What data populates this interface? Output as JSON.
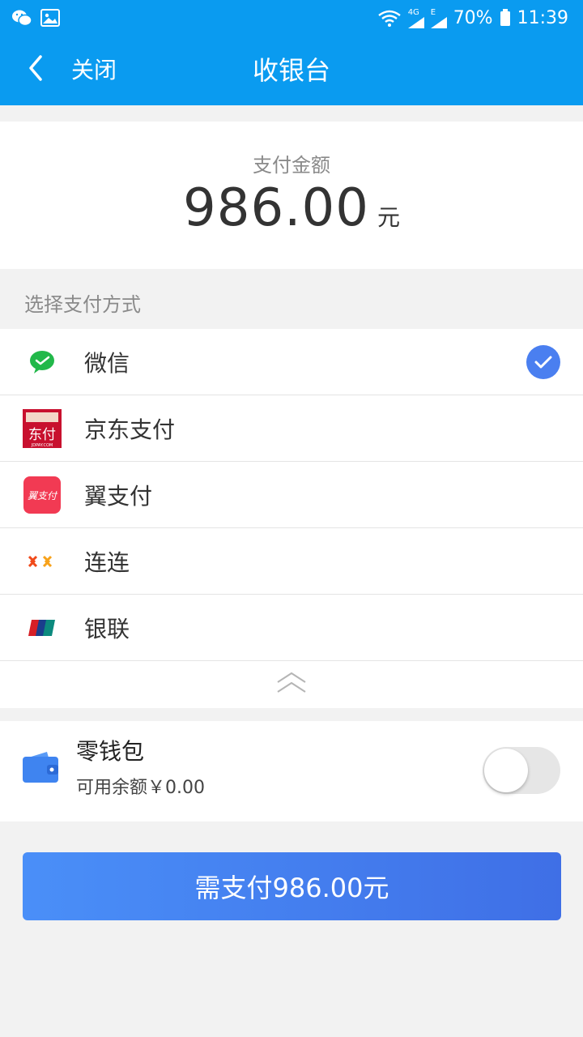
{
  "status_bar": {
    "battery": "70%",
    "time": "11:39",
    "network_4g": "4G",
    "network_e": "E",
    "icons": [
      "wechat-icon",
      "gallery-icon",
      "wifi-icon",
      "signal-icon",
      "battery-icon"
    ]
  },
  "header": {
    "close_label": "关闭",
    "title": "收银台",
    "background": "#0a9bf0"
  },
  "amount": {
    "label": "支付金额",
    "value": "986.00",
    "unit": "元"
  },
  "payment": {
    "section_label": "选择支付方式",
    "selected": "微信",
    "methods": [
      {
        "label": "微信",
        "icon": "wechat-pay-icon",
        "selected": true
      },
      {
        "label": "京东支付",
        "icon": "jdpay-icon",
        "selected": false
      },
      {
        "label": "翼支付",
        "icon": "bestpay-icon",
        "selected": false
      },
      {
        "label": "连连",
        "icon": "lianlian-icon",
        "selected": false
      },
      {
        "label": "银联",
        "icon": "unionpay-icon",
        "selected": false
      }
    ],
    "jd_icon_text": "东付",
    "jd_icon_small": "JDPAY.COM",
    "bestpay_icon_text": "翼支付",
    "check_color": "#4a7ff0"
  },
  "wallet": {
    "title": "零钱包",
    "balance_text": "可用余额￥0.00",
    "toggle_on": false
  },
  "pay_button": {
    "label": "需支付986.00元"
  }
}
